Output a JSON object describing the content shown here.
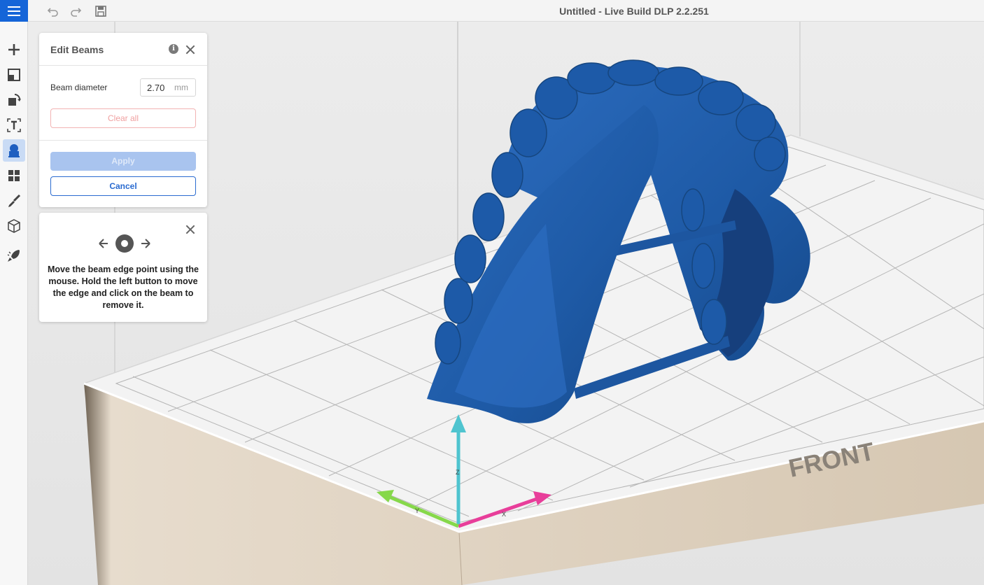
{
  "app": {
    "title": "Untitled - Live Build DLP 2.2.251"
  },
  "toolbar": {
    "items": [
      {
        "name": "add",
        "icon": "plus-icon"
      },
      {
        "name": "layout",
        "icon": "layout-icon"
      },
      {
        "name": "transform",
        "icon": "rotate-cube-icon"
      },
      {
        "name": "text",
        "icon": "text-icon"
      },
      {
        "name": "beams",
        "icon": "beam-support-icon",
        "active": true
      },
      {
        "name": "arrange",
        "icon": "grid-icon"
      },
      {
        "name": "brush",
        "icon": "brush-icon"
      },
      {
        "name": "view",
        "icon": "cube-icon"
      },
      {
        "name": "print",
        "icon": "rocket-icon"
      }
    ]
  },
  "edit_beams": {
    "title": "Edit Beams",
    "beam_diameter_label": "Beam diameter",
    "beam_diameter_value": "2.70",
    "beam_diameter_unit": "mm",
    "clear_label": "Clear all",
    "apply_label": "Apply",
    "cancel_label": "Cancel"
  },
  "hint": {
    "text": "Move the beam edge point using the mouse. Hold the left button to move the edge and click on the beam to remove it."
  },
  "scene": {
    "plate_label": "FRONT",
    "axes": {
      "x": "X",
      "y": "Y",
      "z": "Z"
    },
    "colors": {
      "model": "#1e5aa6",
      "x_axis": "#e83e9a",
      "y_axis": "#86d84a",
      "z_axis": "#4fc4cf",
      "plate_side": "#d8c8b4"
    }
  }
}
